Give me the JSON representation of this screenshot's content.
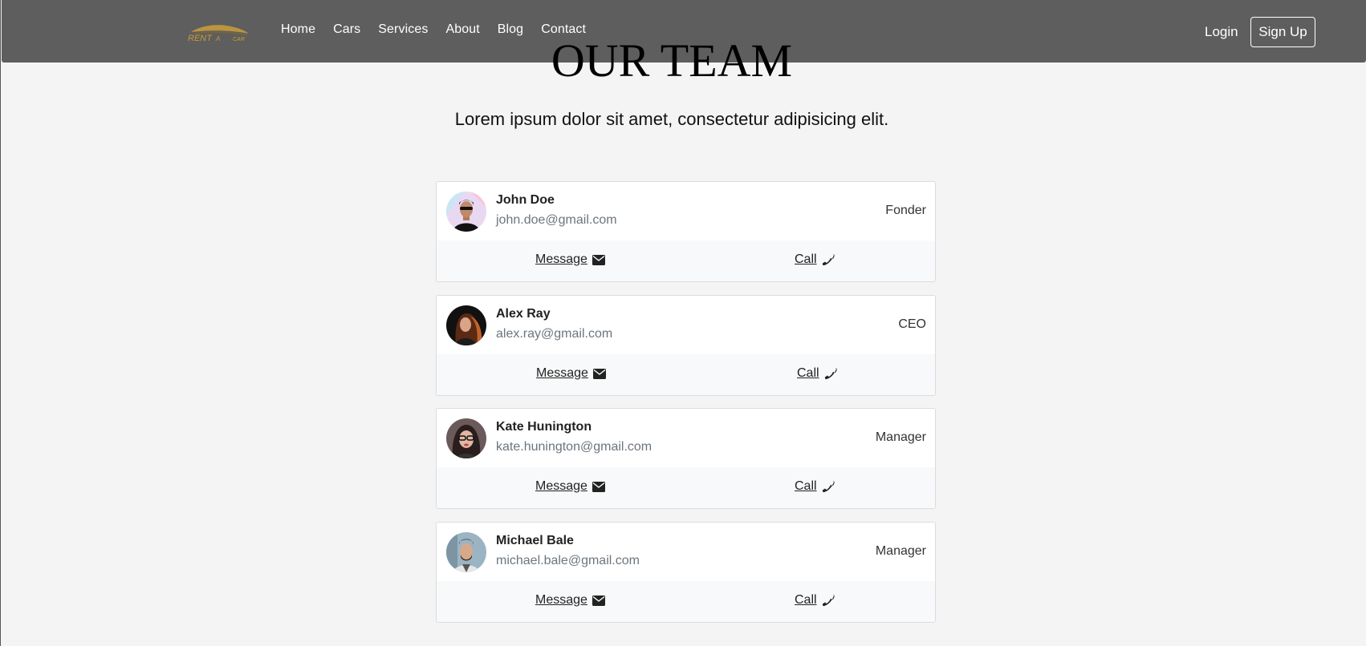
{
  "header": {
    "logo_alt": "RENT A CAR",
    "nav": [
      "Home",
      "Cars",
      "Services",
      "About",
      "Blog",
      "Contact"
    ],
    "login_label": "Login",
    "signup_label": "Sign Up"
  },
  "hero": {
    "title": "OUR TEAM",
    "subtitle": "Lorem ipsum dolor sit amet, consectetur adipisicing elit."
  },
  "team": [
    {
      "name": "John Doe",
      "email": "john.doe@gmail.com",
      "role": "Fonder",
      "message_label": "Message",
      "call_label": "Call"
    },
    {
      "name": "Alex Ray",
      "email": "alex.ray@gmail.com",
      "role": "CEO",
      "message_label": "Message",
      "call_label": "Call"
    },
    {
      "name": "Kate Hunington",
      "email": "kate.hunington@gmail.com",
      "role": "Manager",
      "message_label": "Message",
      "call_label": "Call"
    },
    {
      "name": "Michael Bale",
      "email": "michael.bale@gmail.com",
      "role": "Manager",
      "message_label": "Message",
      "call_label": "Call"
    }
  ],
  "icons": {
    "message": "envelope-icon",
    "call": "phone-icon"
  },
  "colors": {
    "header_bg": "#5e5e5e",
    "page_bg": "#f4f4f4",
    "logo_gold": "#c49a3c"
  }
}
